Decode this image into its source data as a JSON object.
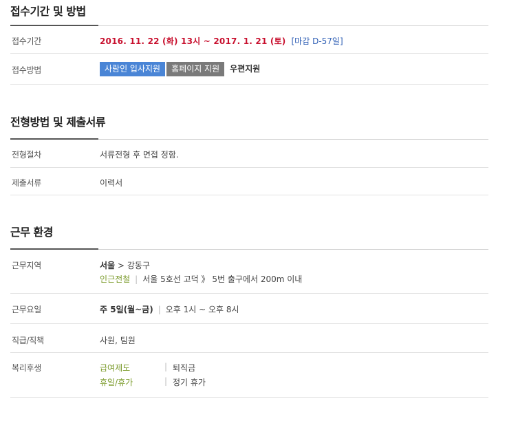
{
  "s1": {
    "title": "접수기간 및 방법",
    "period_label": "접수기간",
    "period_value": "2016. 11. 22 (화) 13시 ~ 2017. 1. 21 (토)",
    "dday": "[마감 D-57일]",
    "method_label": "접수방법",
    "btn_saramin": "사람인 입사지원",
    "btn_homepage": "홈페이지 지원",
    "post": "우편지원"
  },
  "s2": {
    "title": "전형방법 및 제출서류",
    "proc_label": "전형절차",
    "proc_value": "서류전형 후 면접 정함.",
    "docs_label": "제출서류",
    "docs_value": "이력서"
  },
  "s3": {
    "title": "근무 환경",
    "area_label": "근무지역",
    "area_city": "서울",
    "area_arrow": ">",
    "area_district": "강동구",
    "nearby": "인근전철",
    "subway": "서울 5호선 고덕 》 5번 출구에서 200m 이내",
    "days_label": "근무요일",
    "days": "주 5일(월~금)",
    "hours": "오후 1시 ~ 오후 8시",
    "rank_label": "직급/직책",
    "rank_value": "사원, 팀원",
    "welfare_label": "복리후생",
    "welfare": [
      {
        "key": "급여제도",
        "value": "퇴직금"
      },
      {
        "key": "휴일/휴가",
        "value": "정기 휴가"
      }
    ],
    "sep": "|"
  },
  "colors": {
    "red": "#c8102e",
    "blue": "#4a85d6",
    "green": "#7a9a2a",
    "gray_btn": "#7a7a7a"
  }
}
